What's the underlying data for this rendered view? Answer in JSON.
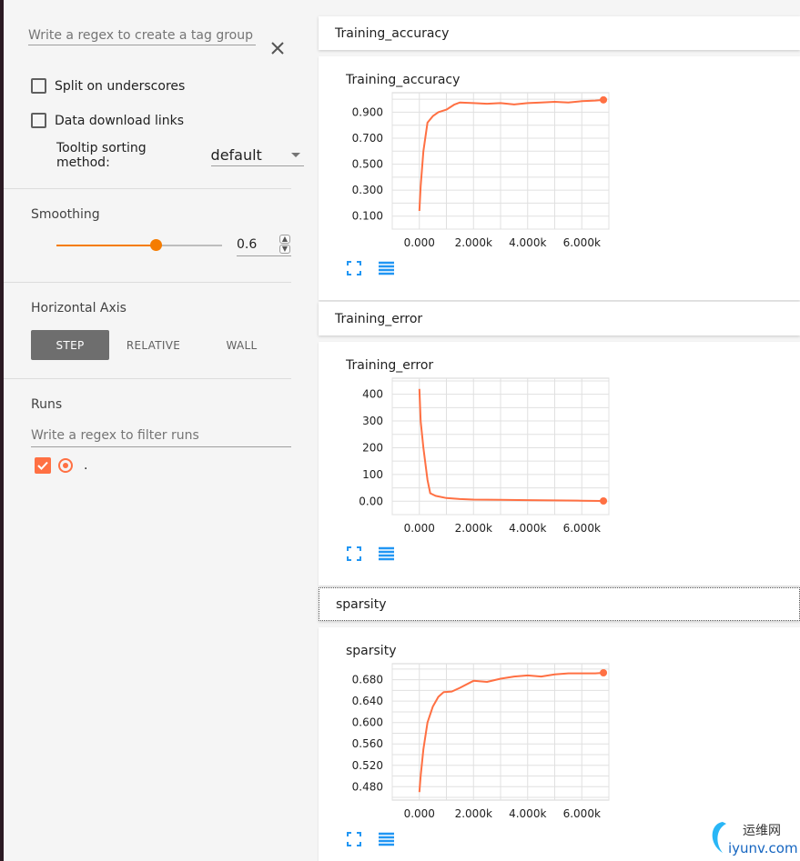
{
  "sidebar": {
    "tag_regex_placeholder": "Write a regex to create a tag group",
    "split_label": "Split on underscores",
    "download_label": "Data download links",
    "tooltip_label": "Tooltip sorting method:",
    "tooltip_value": "default",
    "smoothing_title": "Smoothing",
    "smoothing_value": "0.6",
    "smoothing_fraction": 0.6,
    "axis_title": "Horizontal Axis",
    "axis_options": [
      "STEP",
      "RELATIVE",
      "WALL"
    ],
    "axis_selected": "STEP",
    "runs_title": "Runs",
    "runs_placeholder": "Write a regex to filter runs",
    "run_name": "."
  },
  "colors": {
    "accent": "#f57c00",
    "series": "#ff7043",
    "tool_icon": "#2196f3"
  },
  "groups": [
    {
      "header": "Training_accuracy",
      "card_title": "Training_accuracy"
    },
    {
      "header": "Training_error",
      "card_title": "Training_error"
    },
    {
      "header": "sparsity",
      "card_title": "sparsity"
    }
  ],
  "watermark": {
    "line1": "运维网",
    "line2": "iyunv.com"
  },
  "chart_data": [
    {
      "type": "line",
      "title": "Training_accuracy",
      "xlim": [
        -1000,
        7000
      ],
      "ylim": [
        0.0,
        1.05
      ],
      "xticks": [
        "0.000",
        "2.000k",
        "4.000k",
        "6.000k"
      ],
      "xtick_values": [
        0,
        2000,
        4000,
        6000
      ],
      "yticks": [
        "0.100",
        "0.300",
        "0.500",
        "0.700",
        "0.900"
      ],
      "ytick_values": [
        0.1,
        0.3,
        0.5,
        0.7,
        0.9
      ],
      "grid": true,
      "x": [
        0,
        50,
        150,
        300,
        500,
        700,
        1000,
        1300,
        1500,
        2000,
        2500,
        3000,
        3500,
        4000,
        4500,
        5000,
        5500,
        6000,
        6500,
        6800
      ],
      "y": [
        0.14,
        0.33,
        0.6,
        0.82,
        0.87,
        0.9,
        0.92,
        0.96,
        0.975,
        0.97,
        0.965,
        0.97,
        0.96,
        0.97,
        0.975,
        0.98,
        0.975,
        0.985,
        0.99,
        0.995
      ]
    },
    {
      "type": "line",
      "title": "Training_error",
      "xlim": [
        -1000,
        7000
      ],
      "ylim": [
        -50,
        460
      ],
      "xticks": [
        "0.000",
        "2.000k",
        "4.000k",
        "6.000k"
      ],
      "xtick_values": [
        0,
        2000,
        4000,
        6000
      ],
      "yticks": [
        "0.00",
        "100",
        "200",
        "300",
        "400"
      ],
      "ytick_values": [
        0,
        100,
        200,
        300,
        400
      ],
      "grid": true,
      "x": [
        0,
        50,
        150,
        300,
        400,
        600,
        1000,
        1500,
        2000,
        3000,
        4000,
        5000,
        6000,
        6800
      ],
      "y": [
        420,
        300,
        200,
        80,
        30,
        20,
        12,
        8,
        6,
        5,
        4,
        3,
        2,
        1
      ]
    },
    {
      "type": "line",
      "title": "sparsity",
      "xlim": [
        -1000,
        7000
      ],
      "ylim": [
        0.455,
        0.71
      ],
      "xticks": [
        "0.000",
        "2.000k",
        "4.000k",
        "6.000k"
      ],
      "xtick_values": [
        0,
        2000,
        4000,
        6000
      ],
      "yticks": [
        "0.480",
        "0.520",
        "0.560",
        "0.600",
        "0.640",
        "0.680"
      ],
      "ytick_values": [
        0.48,
        0.52,
        0.56,
        0.6,
        0.64,
        0.68
      ],
      "grid": true,
      "x": [
        0,
        50,
        150,
        300,
        500,
        700,
        900,
        1200,
        1500,
        2000,
        2500,
        3000,
        3500,
        4000,
        4500,
        5000,
        5500,
        6000,
        6500,
        6800
      ],
      "y": [
        0.47,
        0.5,
        0.55,
        0.6,
        0.63,
        0.648,
        0.657,
        0.658,
        0.665,
        0.678,
        0.676,
        0.682,
        0.686,
        0.688,
        0.686,
        0.69,
        0.692,
        0.692,
        0.692,
        0.693
      ]
    }
  ]
}
